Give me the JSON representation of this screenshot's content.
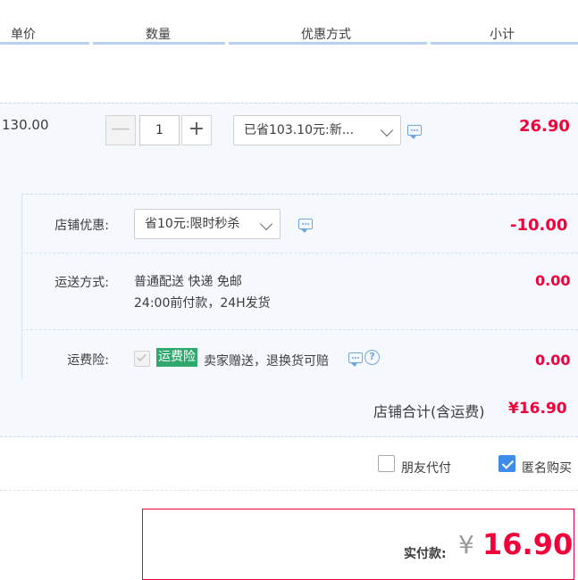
{
  "header": {
    "col_price": "单价",
    "col_qty": "数量",
    "col_discount": "优惠方式",
    "col_subtotal": "小计"
  },
  "item": {
    "unit_price": "130.00",
    "quantity": "1",
    "discount_select": "已省103.10元:新...",
    "subtotal": "26.90"
  },
  "shop": {
    "discount_label": "店铺优惠:",
    "discount_select": "省10元:限时秒杀",
    "discount_amount": "-10.00",
    "shipping_label": "运送方式:",
    "shipping_line1": "普通配送 快递 免邮",
    "shipping_line2": "24:00前付款，24H发货",
    "shipping_amount": "0.00",
    "insurance_label": "运费险:",
    "insurance_tag": "运费险",
    "insurance_desc": "卖家赠送，退换货可赔",
    "insurance_amount": "0.00",
    "total_label": "店铺合计(含运费)",
    "total_amount": "¥16.90"
  },
  "options": {
    "friend_pay": "朋友代付",
    "anonymous": "匿名购买"
  },
  "payment": {
    "label": "实付款:",
    "currency": "¥",
    "amount": "16.90"
  },
  "colors": {
    "accent_red": "#f1003a",
    "accent_blue": "#3f8bea",
    "insurance_green": "#2fa86e"
  }
}
